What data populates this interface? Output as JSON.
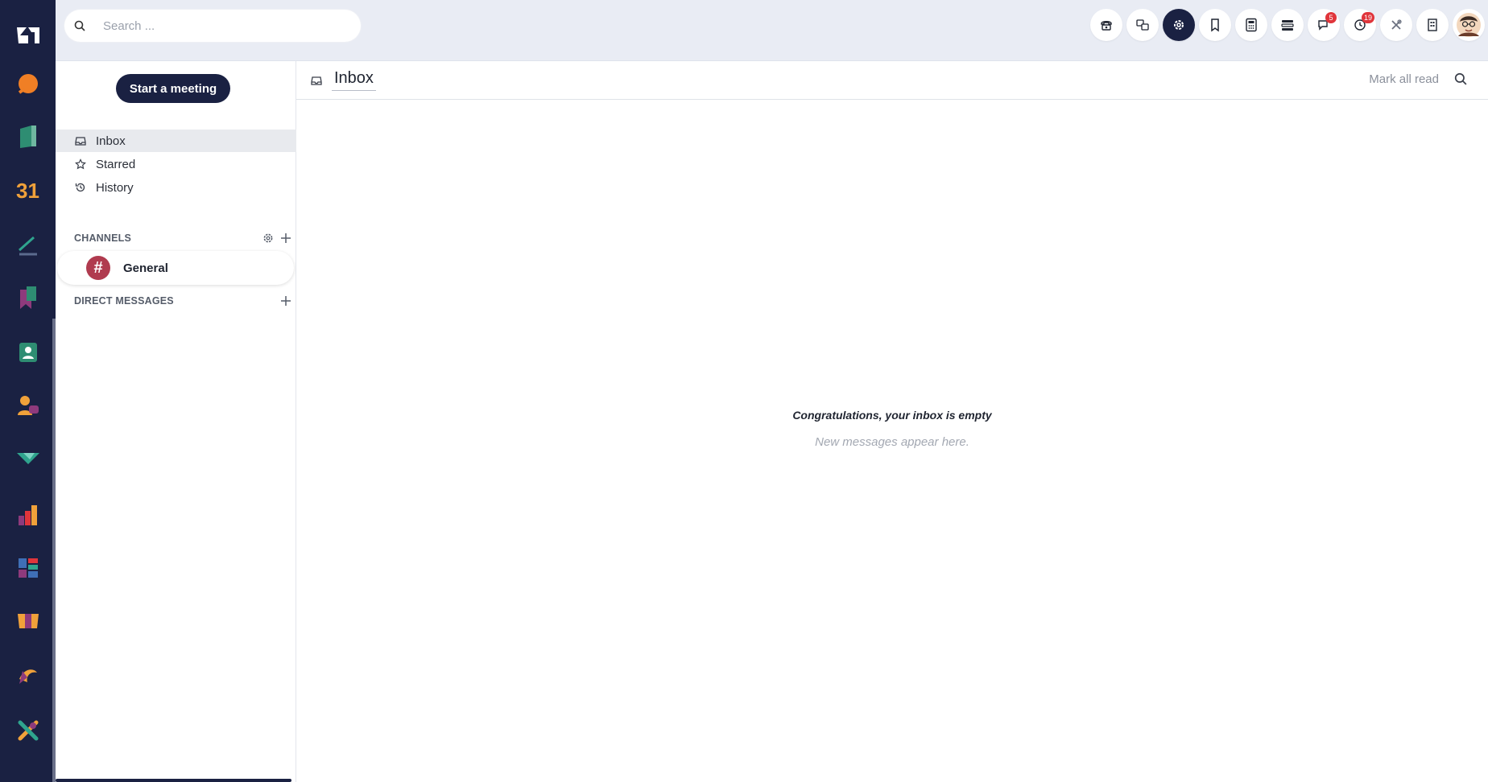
{
  "search": {
    "placeholder": "Search ..."
  },
  "sidebar": {
    "start_meeting_label": "Start a meeting",
    "nav": [
      {
        "label": "Inbox",
        "selected": true
      },
      {
        "label": "Starred",
        "selected": false
      },
      {
        "label": "History",
        "selected": false
      }
    ],
    "channels_heading": "CHANNELS",
    "channels": [
      {
        "symbol": "#",
        "name": "General",
        "color": "#b03b4f"
      }
    ],
    "dm_heading": "DIRECT MESSAGES"
  },
  "topbar": {
    "systray": [
      {
        "icon": "phone-icon"
      },
      {
        "icon": "language-icon"
      },
      {
        "icon": "gear-icon",
        "active": true
      },
      {
        "icon": "bookmark-icon"
      },
      {
        "icon": "calculator-icon"
      },
      {
        "icon": "list-icon"
      },
      {
        "icon": "chat-icon",
        "badge": "5"
      },
      {
        "icon": "clock-icon",
        "badge": "19"
      },
      {
        "icon": "tools-icon"
      },
      {
        "icon": "building-icon"
      },
      {
        "icon": "user-avatar"
      }
    ]
  },
  "main": {
    "title": "Inbox",
    "mark_all_read": "Mark all read",
    "empty_title": "Congratulations, your inbox is empty",
    "empty_subtitle": "New messages appear here."
  },
  "colors": {
    "rail": "#1a2142",
    "accent": "#1a2142",
    "badge": "#e0353b",
    "channel": "#b03b4f"
  }
}
